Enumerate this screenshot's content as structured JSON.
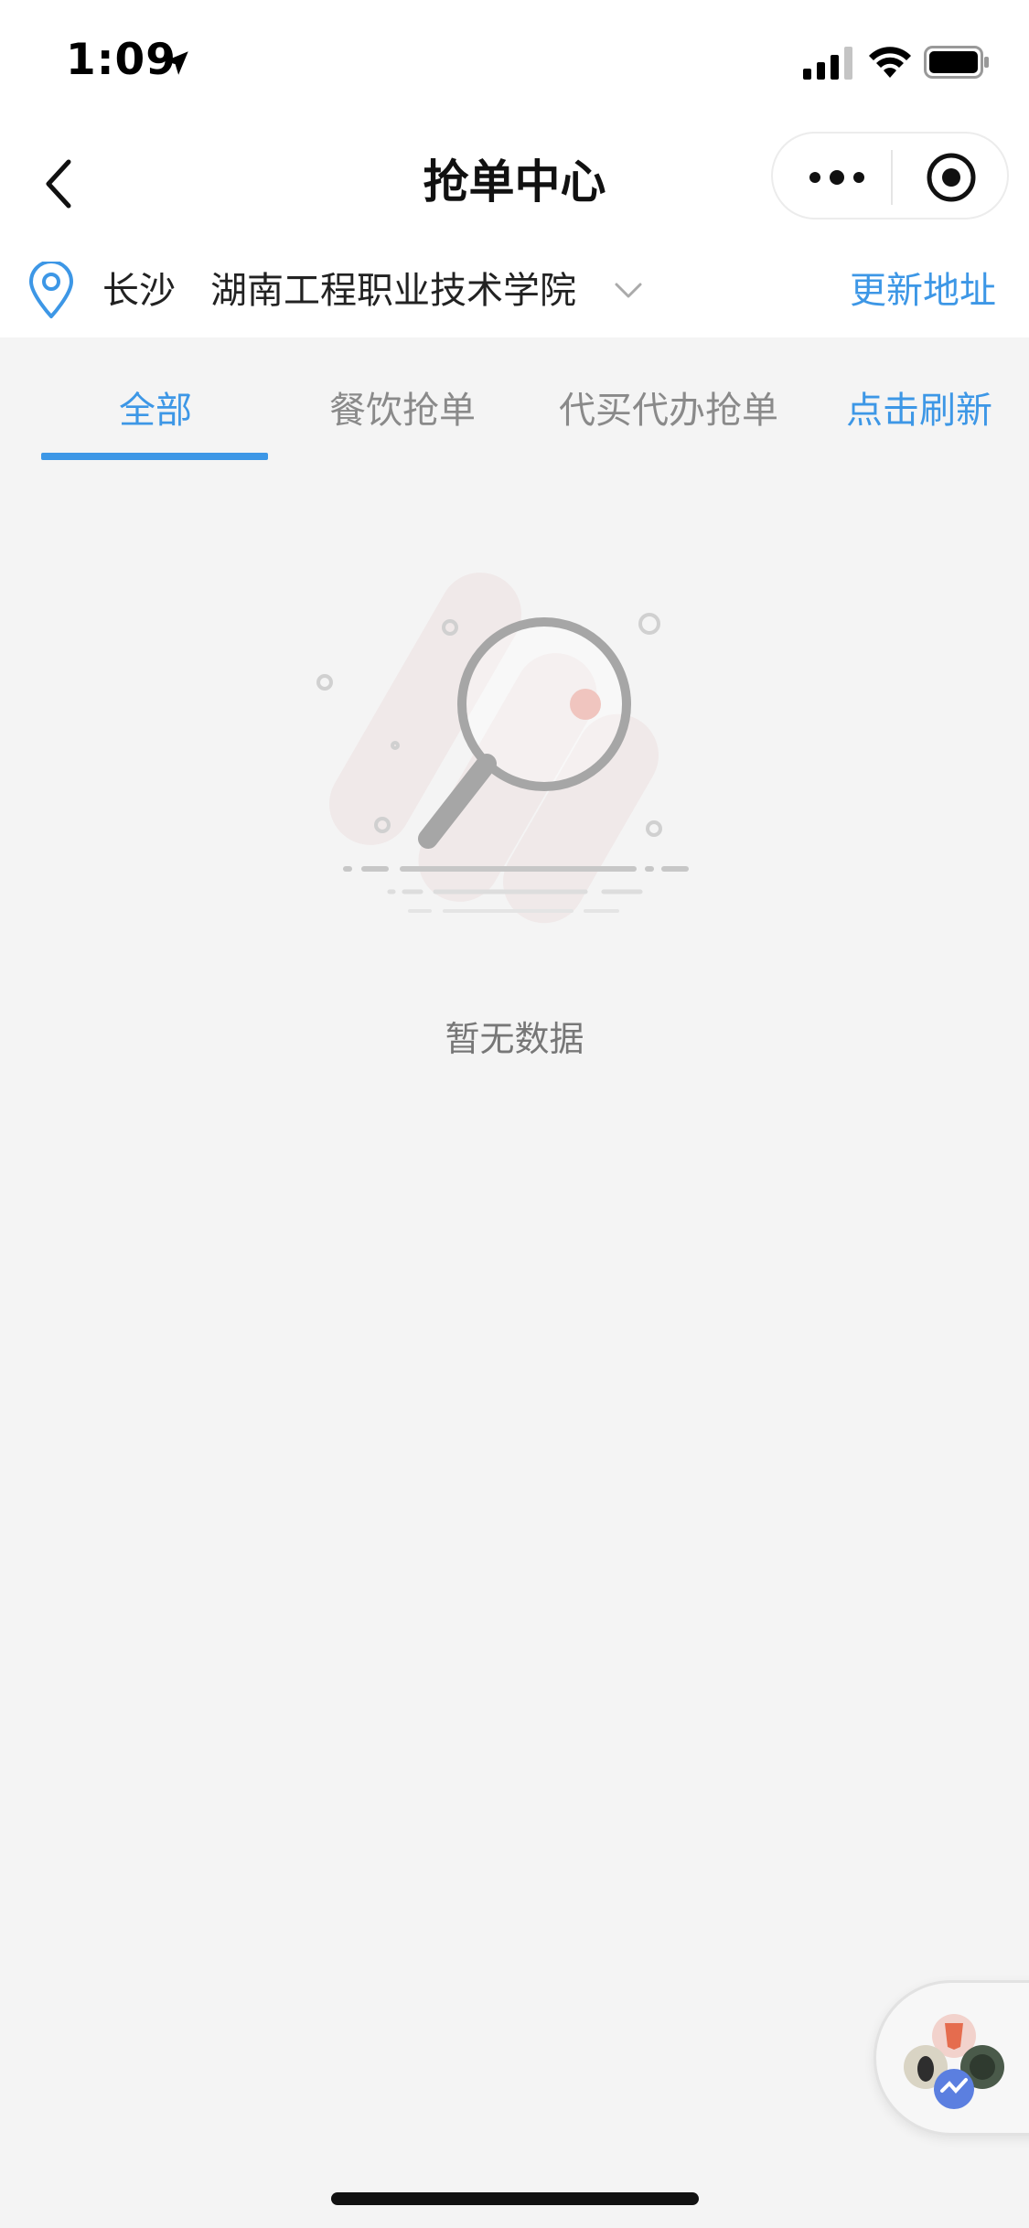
{
  "status_bar": {
    "time": "1:09"
  },
  "nav": {
    "title": "抢单中心"
  },
  "location": {
    "city": "长沙",
    "school": "湖南工程职业技术学院",
    "update_label": "更新地址"
  },
  "tabs": [
    {
      "label": "全部",
      "active": true
    },
    {
      "label": "餐饮抢单",
      "active": false
    },
    {
      "label": "代买代办抢单",
      "active": false
    }
  ],
  "refresh_label": "点击刷新",
  "empty": {
    "text": "暂无数据"
  },
  "colors": {
    "accent": "#3d97e6",
    "background": "#f4f4f4",
    "nav_background": "#ffffff",
    "muted_text": "#8a8a8a"
  },
  "icons": {
    "back": "chevron-left-icon",
    "more": "more-dots-icon",
    "close": "target-close-icon",
    "location": "map-pin-icon",
    "dropdown": "chevron-down-icon",
    "empty": "magnifier-empty-icon"
  }
}
